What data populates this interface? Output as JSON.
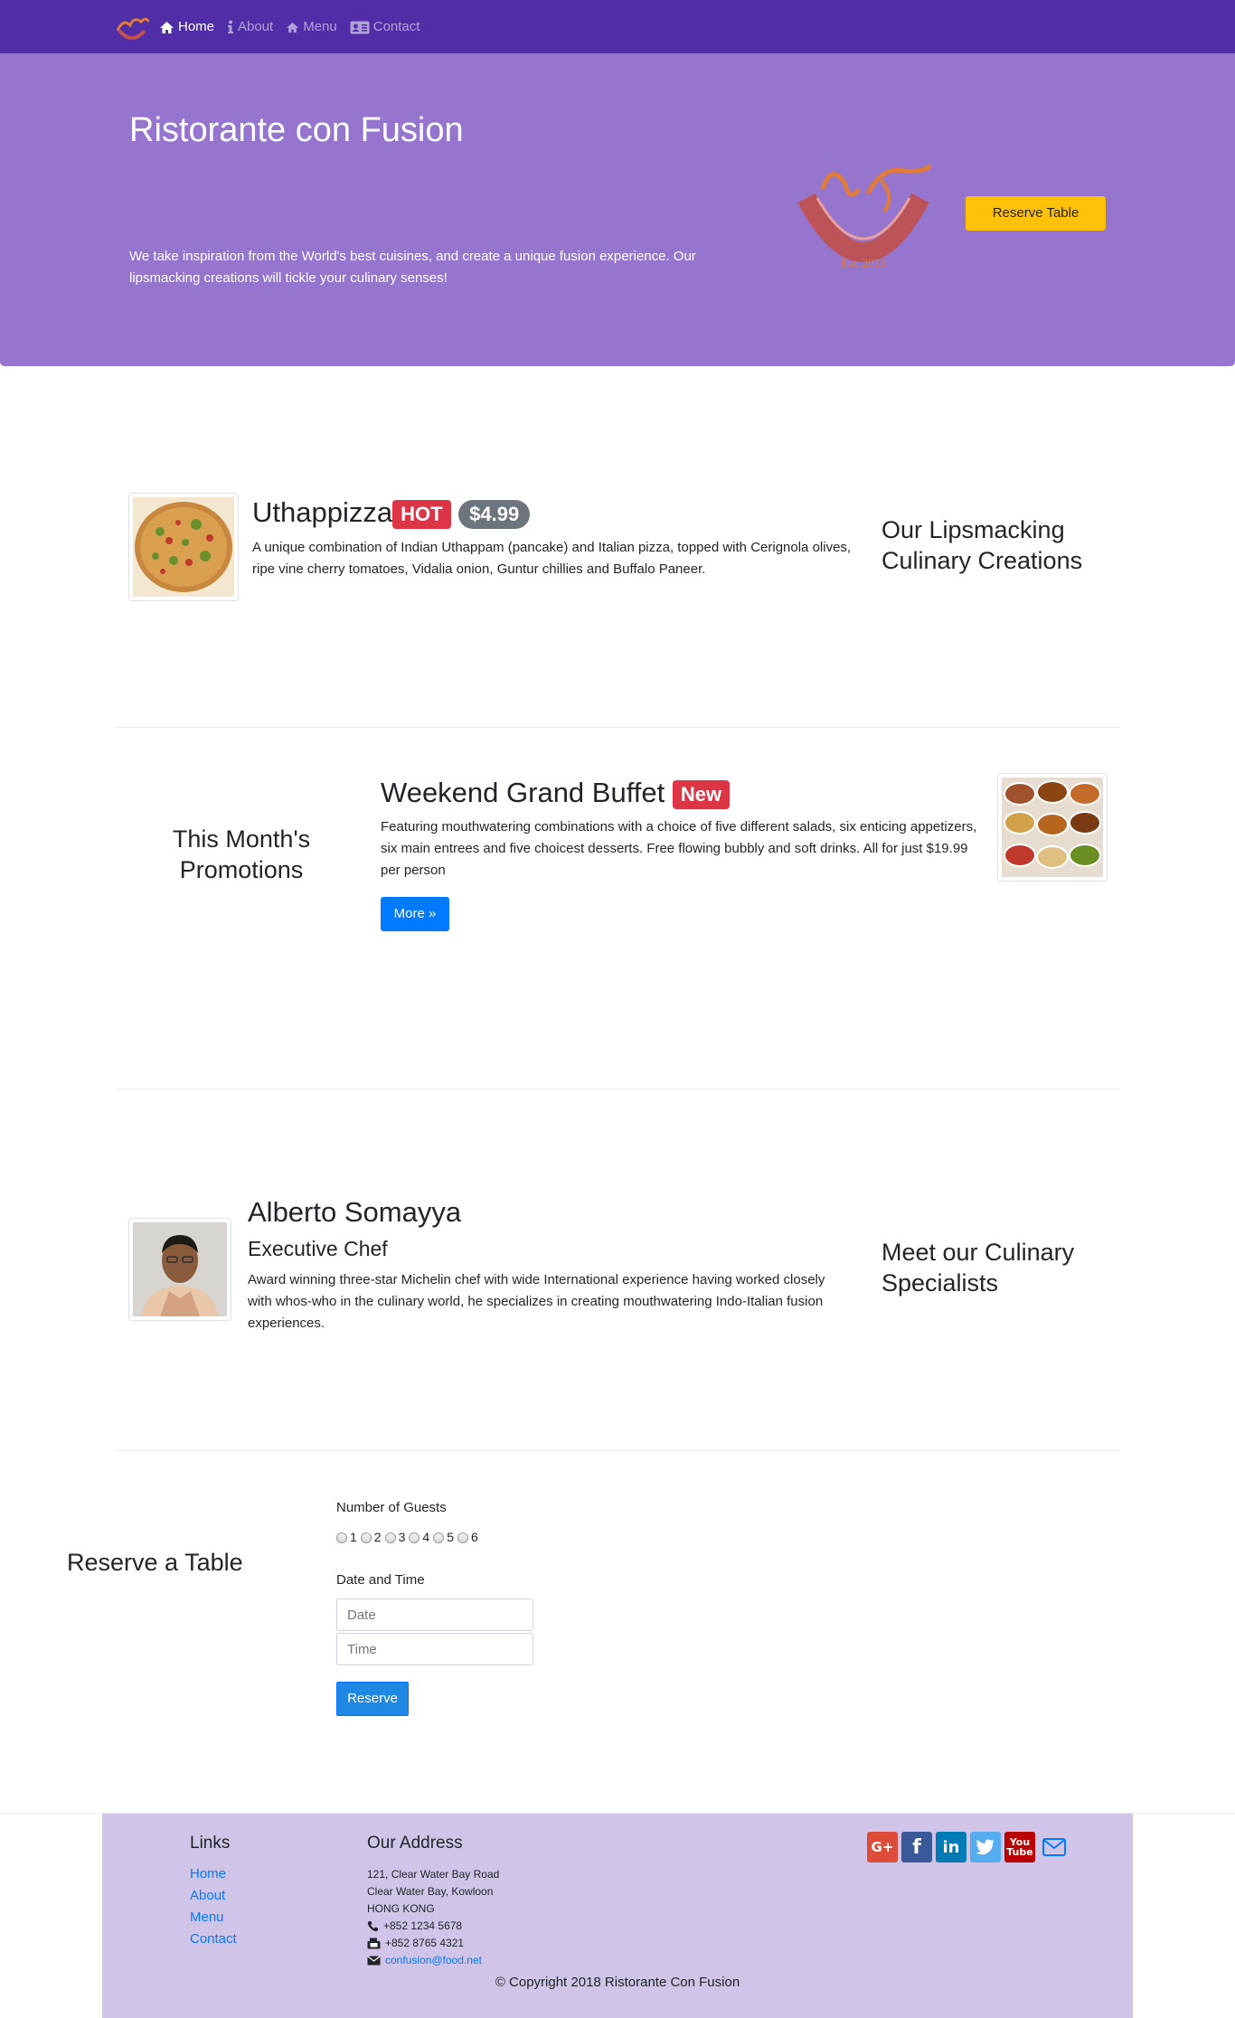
{
  "nav": {
    "items": [
      {
        "label": "Home",
        "icon": "home-icon"
      },
      {
        "label": "About",
        "icon": "info-icon"
      },
      {
        "label": "Menu",
        "icon": "list-icon"
      },
      {
        "label": "Contact",
        "icon": "address-card-icon"
      }
    ]
  },
  "jumbotron": {
    "title": "Ristorante con Fusion",
    "text": "We take inspiration from the World's best cuisines, and create a unique fusion experience. Our lipsmacking creations will tickle your culinary senses!",
    "logo_text": "Ristorante con Fusion",
    "logo_est": "Est. 2013",
    "reserve_label": "Reserve Table"
  },
  "dish": {
    "name": "Uthappizza",
    "badge_hot": "HOT",
    "price": "$4.99",
    "description": "A unique combination of Indian Uthappam (pancake) and Italian pizza, topped with Cerignola olives, ripe vine cherry tomatoes, Vidalia onion, Guntur chillies and Buffalo Paneer.",
    "heading": "Our Lipsmacking Culinary Creations"
  },
  "promotion": {
    "heading": "This Month's Promotions",
    "name": "Weekend Grand Buffet",
    "badge_new": "New",
    "description": "Featuring mouthwatering combinations with a choice of five different salads, six enticing appetizers, six main entrees and five choicest desserts. Free flowing bubbly and soft drinks. All for just $19.99 per person",
    "more_label": "More »"
  },
  "leader": {
    "name": "Alberto Somayya",
    "designation": "Executive Chef",
    "description": "Award winning three-star Michelin chef with wide International experience having worked closely with whos-who in the culinary world, he specializes in creating mouthwatering Indo-Italian fusion experiences.",
    "heading": "Meet our Culinary Specialists"
  },
  "reserve": {
    "heading": "Reserve a Table",
    "guests_label": "Number of Guests",
    "guest_options": [
      "1",
      "2",
      "3",
      "4",
      "5",
      "6"
    ],
    "datetime_label": "Date and Time",
    "date_placeholder": "Date",
    "time_placeholder": "Time",
    "submit_label": "Reserve"
  },
  "footer": {
    "links_heading": "Links",
    "links": [
      "Home",
      "About",
      "Menu",
      "Contact"
    ],
    "address_heading": "Our Address",
    "address_lines": [
      "121, Clear Water Bay Road",
      "Clear Water Bay, Kowloon",
      "HONG KONG"
    ],
    "phone": "+852 1234 5678",
    "fax": "+852 8765 4321",
    "email": "confusion@food.net",
    "socials": [
      {
        "icon": "google-plus-icon",
        "color": "#dd4b39"
      },
      {
        "icon": "facebook-icon",
        "color": "#3b5998"
      },
      {
        "icon": "linkedin-icon",
        "color": "#007bb6"
      },
      {
        "icon": "twitter-icon",
        "color": "#55acee"
      },
      {
        "icon": "youtube-icon",
        "color": "#bb0000"
      },
      {
        "icon": "mail-icon",
        "color": "#007bff"
      }
    ],
    "copyright": "© Copyright 2018 Ristorante Con Fusion"
  },
  "colors": {
    "primary_dark": "#512da8",
    "primary_light": "#9575cd",
    "footer_bg": "#d1c4e9",
    "accent": "#ffc107"
  }
}
